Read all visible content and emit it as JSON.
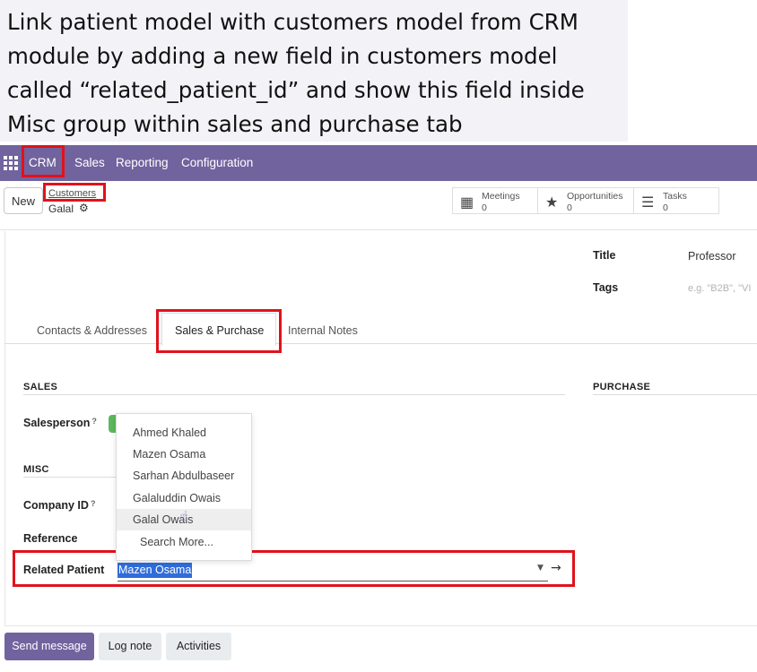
{
  "caption": {
    "lines": [
      "Link patient model with customers model from CRM",
      "module by adding a new field in customers model",
      "called “related_patient_id” and show this field inside",
      "Misc group within sales and purchase tab"
    ]
  },
  "navbar": {
    "app": "CRM",
    "menu": [
      "Sales",
      "Reporting",
      "Configuration"
    ]
  },
  "control": {
    "new_label": "New",
    "breadcrumb": "Customers",
    "record": "Galal",
    "smart_buttons": [
      {
        "label": "Meetings",
        "count": "0",
        "icon": "calendar-icon"
      },
      {
        "label": "Opportunities",
        "count": "0",
        "icon": "star-icon"
      },
      {
        "label": "Tasks",
        "count": "0",
        "icon": "tasks-icon"
      }
    ]
  },
  "form": {
    "title_label": "Title",
    "title_value": "Professor",
    "tags_label": "Tags",
    "tags_placeholder": "e.g. \"B2B\", \"VI",
    "tabs": [
      "Contacts & Addresses",
      "Sales & Purchase",
      "Internal Notes"
    ],
    "sales_title": "SALES",
    "purchase_title": "PURCHASE",
    "salesperson_label": "Salesperson",
    "misc_title": "MISC",
    "company_id_label": "Company ID",
    "reference_label": "Reference",
    "related_patient_label": "Related Patient",
    "related_patient_value": "Mazen Osama",
    "tooltip_mark": "?"
  },
  "dropdown": {
    "options": [
      "Ahmed Khaled",
      "Mazen Osama",
      "Sarhan Abdulbaseer",
      "Galaluddin Owais",
      "Galal Owais"
    ],
    "search_more": "Search More..."
  },
  "chatter": {
    "send_message": "Send message",
    "log_note": "Log note",
    "activities": "Activities"
  },
  "colors": {
    "navbar": "#71639e",
    "highlight_box": "#e0121b",
    "primary_button": "#71639e",
    "selection": "#2f6ddb"
  }
}
